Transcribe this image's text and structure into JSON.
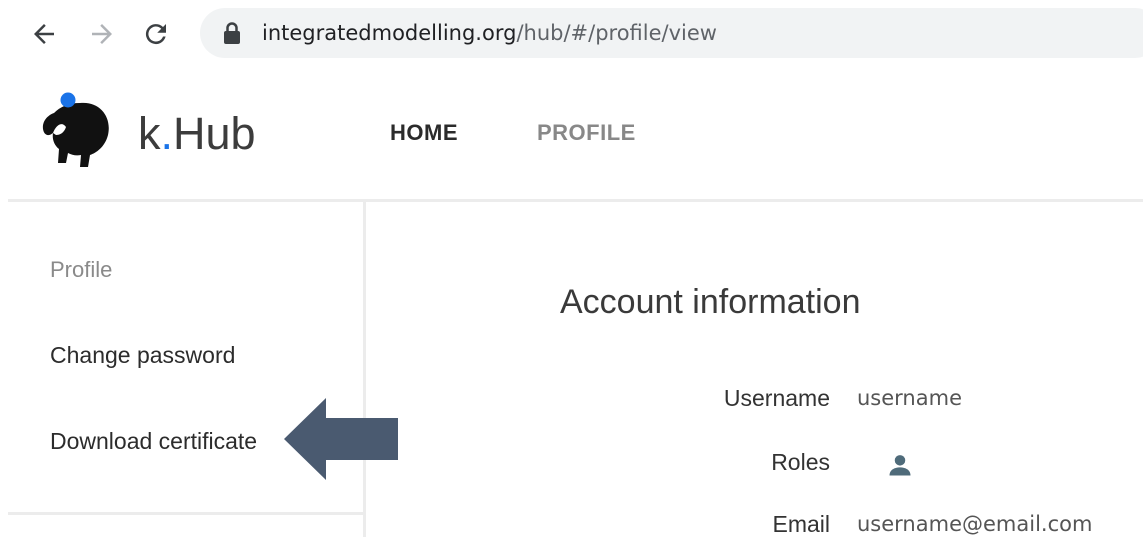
{
  "browser": {
    "url_host": "integratedmodelling.org",
    "url_path": "/hub/#/profile/view",
    "icons": {
      "back": "arrow-left-icon",
      "forward": "arrow-right-icon",
      "reload": "reload-icon",
      "lock": "lock-icon"
    }
  },
  "header": {
    "brand_prefix": "k",
    "brand_dot": ".",
    "brand_suffix": "Hub",
    "tabs": [
      {
        "label": "HOME",
        "active": true
      },
      {
        "label": "PROFILE",
        "active": false
      }
    ]
  },
  "sidebar": {
    "items": [
      {
        "label": "Profile"
      },
      {
        "label": "Change password"
      },
      {
        "label": "Download certificate"
      }
    ]
  },
  "account": {
    "title": "Account information",
    "fields": [
      {
        "label": "Username",
        "value": "username"
      },
      {
        "label": "Roles",
        "value_icon": "user-icon"
      },
      {
        "label": "Email",
        "value": "username@email.com"
      }
    ]
  },
  "colors": {
    "accent": "#1a73e8",
    "arrow": "#4a5a70",
    "role_icon": "#4f6b7a"
  }
}
